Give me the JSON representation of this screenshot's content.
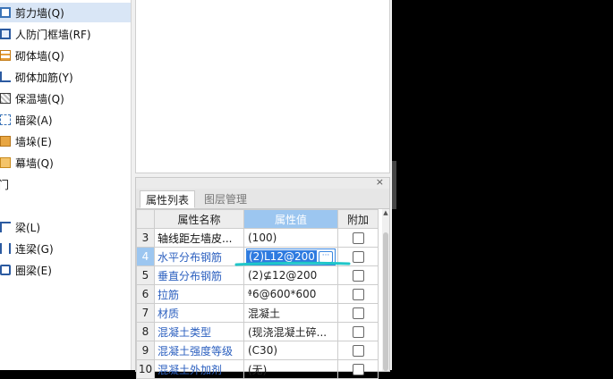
{
  "tree": {
    "items": [
      {
        "label": "剪力墙(Q)",
        "icon": "shear-wall-icon",
        "selected": true
      },
      {
        "label": "人防门框墙(RF)",
        "icon": "door-frame-wall-icon",
        "selected": false
      },
      {
        "label": "砌体墙(Q)",
        "icon": "masonry-wall-icon",
        "selected": false
      },
      {
        "label": "砌体加筋(Y)",
        "icon": "masonry-rebar-icon",
        "selected": false
      },
      {
        "label": "保温墙(Q)",
        "icon": "insulation-wall-icon",
        "selected": false
      },
      {
        "label": "暗梁(A)",
        "icon": "hidden-beam-icon",
        "selected": false
      },
      {
        "label": "墙垛(E)",
        "icon": "wall-pier-icon",
        "selected": false
      },
      {
        "label": "幕墙(Q)",
        "icon": "curtain-wall-icon",
        "selected": false
      }
    ],
    "category_fragment": "门",
    "items2": [
      {
        "label": "梁(L)",
        "icon": "beam-icon"
      },
      {
        "label": "连梁(G)",
        "icon": "coupling-beam-icon"
      },
      {
        "label": "圈梁(E)",
        "icon": "ring-beam-icon"
      }
    ]
  },
  "panel": {
    "close_glyph": "×",
    "tabs": [
      {
        "label": "属性列表",
        "active": true
      },
      {
        "label": "图层管理",
        "active": false
      }
    ],
    "headers": {
      "num": "",
      "name": "属性名称",
      "value": "属性值",
      "add": "附加"
    },
    "rows": [
      {
        "num": "3",
        "name": "轴线距左墙皮...",
        "value": "(100)",
        "blue": false
      },
      {
        "num": "4",
        "name": "水平分布钢筋",
        "value": "(2)L12@200",
        "blue": true,
        "selected": true,
        "editing": true
      },
      {
        "num": "5",
        "name": "垂直分布钢筋",
        "value": "(2)⊈12@200",
        "blue": true
      },
      {
        "num": "6",
        "name": "拉筋",
        "value": "ᶲ6@600*600",
        "blue": true
      },
      {
        "num": "7",
        "name": "材质",
        "value": "混凝土",
        "blue": true
      },
      {
        "num": "8",
        "name": "混凝土类型",
        "value": "(现浇混凝土碎...",
        "blue": true
      },
      {
        "num": "9",
        "name": "混凝土强度等级",
        "value": "(C30)",
        "blue": true
      },
      {
        "num": "10",
        "name": "混凝土外加剂",
        "value": "(无)",
        "blue": true
      }
    ],
    "ellipsis_glyph": "···"
  },
  "colors": {
    "accent": "#9cc6f0",
    "selection_blue": "#2f7be0",
    "link_blue": "#2b5fbf",
    "annotation_cyan": "#1fc6c9"
  }
}
